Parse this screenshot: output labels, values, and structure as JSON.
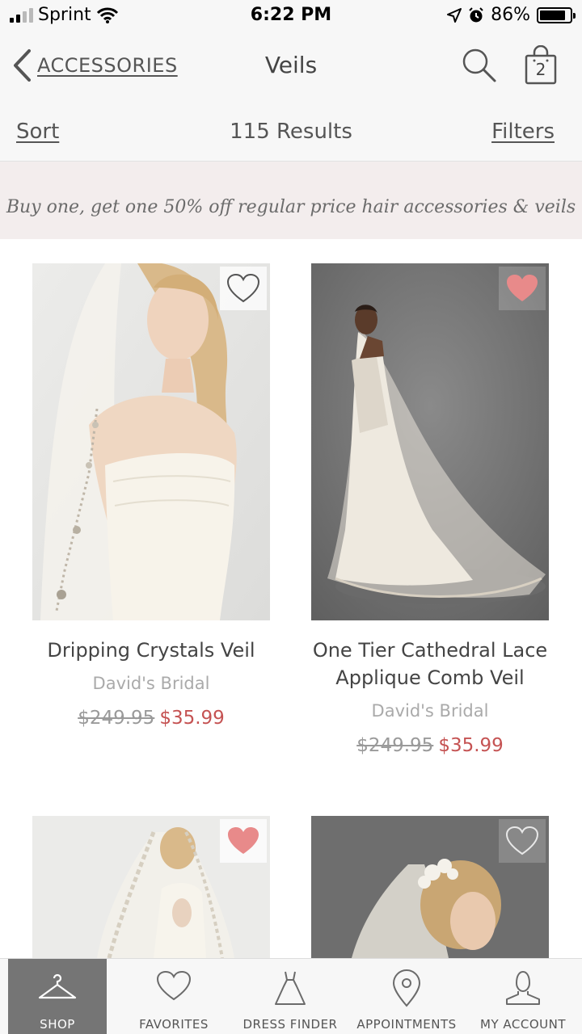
{
  "status_bar": {
    "carrier": "Sprint",
    "time": "6:22 PM",
    "battery": "86%",
    "battery_level": 0.86
  },
  "nav": {
    "back_label": "ACCESSORIES",
    "title": "Veils",
    "bag_count": "2"
  },
  "toolbar": {
    "sort_label": "Sort",
    "results": "115 Results",
    "filters_label": "Filters"
  },
  "promo": {
    "text": "Buy one, get one 50% off regular price hair accessories & veils"
  },
  "products": [
    {
      "name": "Dripping Crystals Veil",
      "brand": "David's Bridal",
      "old_price": "$249.95",
      "sale_price": "$35.99",
      "favorited": false
    },
    {
      "name": "One Tier Cathedral Lace Applique Comb Veil",
      "brand": "David's Bridal",
      "old_price": "$249.95",
      "sale_price": "$35.99",
      "favorited": true
    },
    {
      "favorited": true
    },
    {
      "favorited": false
    }
  ],
  "tabs": [
    {
      "label": "SHOP",
      "icon": "hanger-icon",
      "active": true
    },
    {
      "label": "FAVORITES",
      "icon": "heart-icon",
      "active": false
    },
    {
      "label": "DRESS FINDER",
      "icon": "dress-icon",
      "active": false
    },
    {
      "label": "APPOINTMENTS",
      "icon": "location-pin-icon",
      "active": false
    },
    {
      "label": "MY ACCOUNT",
      "icon": "person-icon",
      "active": false
    }
  ],
  "colors": {
    "accent_sale": "#c55353",
    "favorite_heart": "#e88a8a",
    "active_tab": "#757575",
    "promo_bg": "#f3eded"
  }
}
